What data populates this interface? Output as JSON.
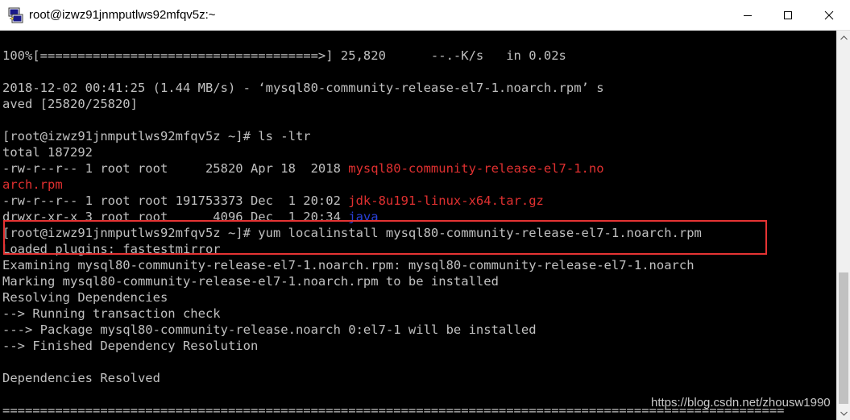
{
  "window": {
    "title": "root@izwz91jnmputlws92mfqv5z:~",
    "app_icon": "putty-icon",
    "controls": [
      "minimize-icon",
      "maximize-icon",
      "close-icon"
    ]
  },
  "terminal": {
    "lines": [
      {
        "segments": [
          {
            "text": "100%[=====================================>] 25,820      --.-K/s   in 0.02s"
          }
        ]
      },
      {
        "segments": [
          {
            "text": ""
          }
        ]
      },
      {
        "segments": [
          {
            "text": "2018-12-02 00:41:25 (1.44 MB/s) - ‘mysql80-community-release-el7-1.noarch.rpm’ s"
          }
        ]
      },
      {
        "segments": [
          {
            "text": "aved [25820/25820]"
          }
        ]
      },
      {
        "segments": [
          {
            "text": ""
          }
        ]
      },
      {
        "segments": [
          {
            "text": "[root@izwz91jnmputlws92mfqv5z ~]# ls -ltr"
          }
        ]
      },
      {
        "segments": [
          {
            "text": "total 187292"
          }
        ]
      },
      {
        "segments": [
          {
            "text": "-rw-r--r-- 1 root root     25820 Apr 18  2018 "
          },
          {
            "text": "mysql80-community-release-el7-1.no",
            "color": "red"
          }
        ]
      },
      {
        "segments": [
          {
            "text": "arch.rpm",
            "color": "red"
          }
        ]
      },
      {
        "segments": [
          {
            "text": "-rw-r--r-- 1 root root 191753373 Dec  1 20:02 "
          },
          {
            "text": "jdk-8u191-linux-x64.tar.gz",
            "color": "red"
          }
        ]
      },
      {
        "segments": [
          {
            "text": "drwxr-xr-x 3 root root      4096 Dec  1 20:34 "
          },
          {
            "text": "java",
            "color": "blue"
          }
        ]
      },
      {
        "segments": [
          {
            "text": "[root@izwz91jnmputlws92mfqv5z ~]# yum localinstall mysql80-community-release-el7-1.noarch.rpm"
          }
        ]
      },
      {
        "segments": [
          {
            "text": "Loaded plugins: fastestmirror"
          }
        ]
      },
      {
        "segments": [
          {
            "text": "Examining mysql80-community-release-el7-1.noarch.rpm: mysql80-community-release-el7-1.noarch"
          }
        ]
      },
      {
        "segments": [
          {
            "text": "Marking mysql80-community-release-el7-1.noarch.rpm to be installed"
          }
        ]
      },
      {
        "segments": [
          {
            "text": "Resolving Dependencies"
          }
        ]
      },
      {
        "segments": [
          {
            "text": "--> Running transaction check"
          }
        ]
      },
      {
        "segments": [
          {
            "text": "---> Package mysql80-community-release.noarch 0:el7-1 will be installed"
          }
        ]
      },
      {
        "segments": [
          {
            "text": "--> Finished Dependency Resolution"
          }
        ]
      },
      {
        "segments": [
          {
            "text": ""
          }
        ]
      },
      {
        "segments": [
          {
            "text": "Dependencies Resolved"
          }
        ]
      },
      {
        "segments": [
          {
            "text": ""
          }
        ]
      },
      {
        "segments": [
          {
            "text": "========================================================================================================"
          }
        ]
      }
    ],
    "highlighted_command": "yum localinstall mysql80-community-release-el7-1.noarch.rpm"
  },
  "colors": {
    "terminal_bg": "#000000",
    "terminal_fg": "#c0c0c0",
    "file_red": "#e03030",
    "dir_blue": "#2a40d8",
    "highlight_border": "#e53333"
  },
  "watermark": "https://blog.csdn.net/zhousw1990",
  "scrollbar": {
    "icons": [
      "scroll-up-icon",
      "scroll-down-icon"
    ]
  }
}
